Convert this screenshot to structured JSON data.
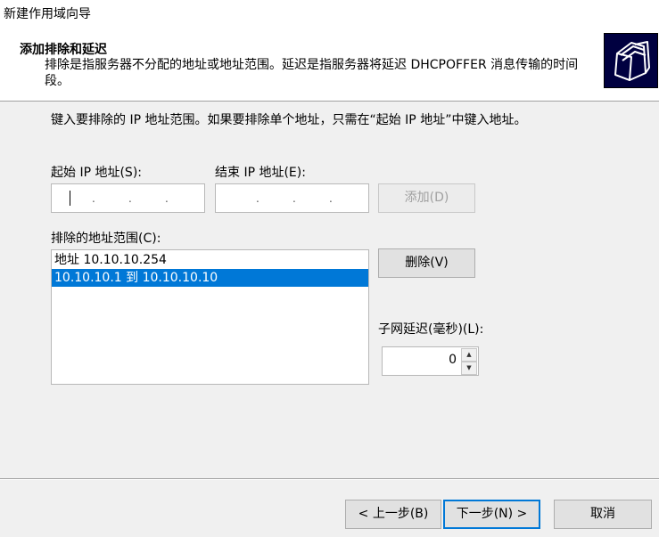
{
  "window": {
    "title": "新建作用域向导"
  },
  "header": {
    "title": "添加排除和延迟",
    "description": "排除是指服务器不分配的地址或地址范围。延迟是指服务器将延迟 DHCPOFFER 消息传输的时间段。",
    "icon": "folders-icon"
  },
  "instruction": "键入要排除的 IP 地址范围。如果要排除单个地址，只需在“起始 IP 地址”中键入地址。",
  "start_ip": {
    "label": "起始 IP 地址(S):",
    "value": ""
  },
  "end_ip": {
    "label": "结束 IP 地址(E):",
    "value": ""
  },
  "add_button": "添加(D)",
  "excluded": {
    "label": "排除的地址范围(C):",
    "items": [
      "地址 10.10.10.254",
      "10.10.10.1 到 10.10.10.10"
    ],
    "selected_index": 1
  },
  "remove_button": "删除(V)",
  "delay": {
    "label": "子网延迟(毫秒)(L):",
    "value": "0"
  },
  "footer": {
    "back": "< 上一步(B)",
    "next": "下一步(N) >",
    "cancel": "取消"
  },
  "colors": {
    "selection": "#0078d7",
    "icon_bg": "#000040"
  }
}
